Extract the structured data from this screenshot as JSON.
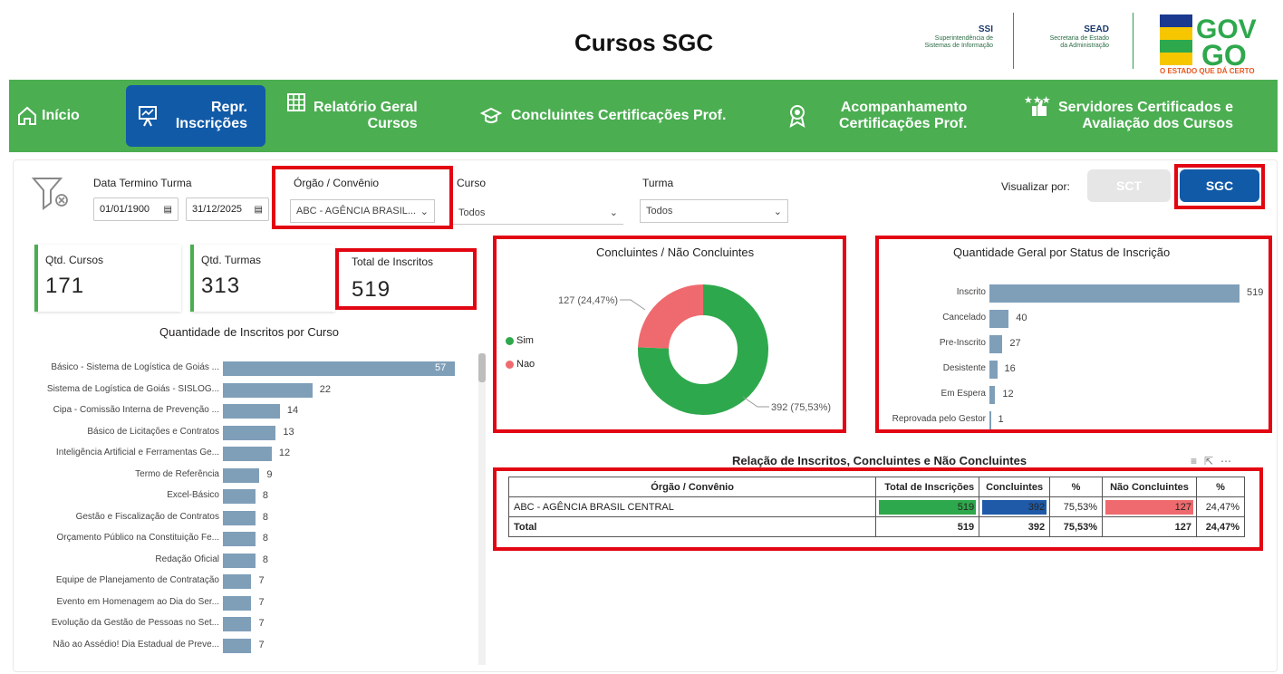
{
  "header": {
    "title": "Cursos SGC",
    "org1_abbr": "SSI",
    "org1_line1": "Superintendência de",
    "org1_line2": "Sistemas de Informação",
    "org2_abbr": "SEAD",
    "org2_line1": "Secretaria de Estado",
    "org2_line2": "da Administração",
    "logo_text": "GOV GO",
    "logo_tagline": "O ESTADO QUE DÁ CERTO"
  },
  "nav": [
    {
      "line1": "Início",
      "line2": "",
      "icon": "home-icon"
    },
    {
      "line1": "Repr.",
      "line2": "Inscrições",
      "icon": "presentation-icon"
    },
    {
      "line1": "Relatório Geral",
      "line2": "Cursos",
      "icon": "grid-icon"
    },
    {
      "line1": "Concluintes Certificações Prof.",
      "line2": "",
      "icon": "graduation-cap-icon"
    },
    {
      "line1": "Acompanhamento",
      "line2": "Certificações Prof.",
      "icon": "award-icon"
    },
    {
      "line1": "Servidores Certificados e",
      "line2": "Avaliação dos Cursos",
      "icon": "stars-thumb-icon"
    }
  ],
  "filters": {
    "date_label": "Data Termino Turma",
    "date_from": "01/01/1900",
    "date_to": "31/12/2025",
    "orgao_label": "Órgão / Convênio",
    "orgao_value": "ABC - AGÊNCIA BRASIL...",
    "curso_label": "Curso",
    "curso_value": "Todos",
    "turma_label": "Turma",
    "turma_value": "Todos",
    "visualizar_label": "Visualizar por:",
    "btn_sct": "SCT",
    "btn_sgc": "SGC"
  },
  "cards": [
    {
      "label": "Qtd. Cursos",
      "value": "171"
    },
    {
      "label": "Qtd. Turmas",
      "value": "313"
    },
    {
      "label": "Total de Inscritos",
      "value": "519"
    }
  ],
  "courses_chart": {
    "title": "Quantidade de Inscritos por Curso",
    "max": 57,
    "items": [
      {
        "label": "Básico - Sistema de Logística de Goiás ...",
        "value": 57
      },
      {
        "label": "Sistema de Logística de Goiás - SISLOG...",
        "value": 22
      },
      {
        "label": "Cipa - Comissão Interna de Prevenção ...",
        "value": 14
      },
      {
        "label": "Básico de Licitações e Contratos",
        "value": 13
      },
      {
        "label": "Inteligência Artificial e Ferramentas Ge...",
        "value": 12
      },
      {
        "label": "Termo de Referência",
        "value": 9
      },
      {
        "label": "Excel-Básico",
        "value": 8
      },
      {
        "label": "Gestão e Fiscalização de Contratos",
        "value": 8
      },
      {
        "label": "Orçamento Público na Constituição Fe...",
        "value": 8
      },
      {
        "label": "Redação Oficial",
        "value": 8
      },
      {
        "label": "Equipe de Planejamento de Contratação",
        "value": 7
      },
      {
        "label": "Evento em Homenagem ao Dia do Ser...",
        "value": 7
      },
      {
        "label": "Evolução da Gestão de Pessoas no Set...",
        "value": 7
      },
      {
        "label": "Não ao Assédio! Dia Estadual de Preve...",
        "value": 7
      }
    ]
  },
  "donut": {
    "title": "Concluintes / Não Concluintes",
    "legend": [
      {
        "name": "Sim",
        "color": "#2ea84c"
      },
      {
        "name": "Nao",
        "color": "#ef6a6e"
      }
    ],
    "slices": [
      {
        "name": "Sim",
        "value": 392,
        "label": "392 (75,53%)",
        "color": "#2ea84c"
      },
      {
        "name": "Nao",
        "value": 127,
        "label": "127 (24,47%)",
        "color": "#ef6a6e"
      }
    ]
  },
  "status_chart": {
    "title": "Quantidade Geral por Status de Inscrição",
    "max": 519,
    "items": [
      {
        "label": "Inscrito",
        "value": 519
      },
      {
        "label": "Cancelado",
        "value": 40
      },
      {
        "label": "Pre-Inscrito",
        "value": 27
      },
      {
        "label": "Desistente",
        "value": 16
      },
      {
        "label": "Em Espera",
        "value": 12
      },
      {
        "label": "Reprovada pelo Gestor",
        "value": 1
      }
    ]
  },
  "table": {
    "title": "Relação de Inscritos, Concluintes e Não Concluintes",
    "headers": [
      "Órgão / Convênio",
      "Total de Inscrições",
      "Concluintes",
      "%",
      "Não Concluintes",
      "%"
    ],
    "row": [
      "ABC - AGÊNCIA BRASIL CENTRAL",
      "519",
      "392",
      "75,53%",
      "127",
      "24,47%"
    ],
    "total": [
      "Total",
      "519",
      "392",
      "75,53%",
      "127",
      "24,47%"
    ]
  },
  "chart_data": [
    {
      "type": "bar",
      "title": "Quantidade de Inscritos por Curso",
      "categories": [
        "Básico - Sistema de Logística de Goiás ...",
        "Sistema de Logística de Goiás - SISLOG...",
        "Cipa - Comissão Interna de Prevenção ...",
        "Básico de Licitações e Contratos",
        "Inteligência Artificial e Ferramentas Ge...",
        "Termo de Referência",
        "Excel-Básico",
        "Gestão e Fiscalização de Contratos",
        "Orçamento Público na Constituição Fe...",
        "Redação Oficial",
        "Equipe de Planejamento de Contratação",
        "Evento em Homenagem ao Dia do Ser...",
        "Evolução da Gestão de Pessoas no Set...",
        "Não ao Assédio! Dia Estadual de Preve..."
      ],
      "values": [
        57,
        22,
        14,
        13,
        12,
        9,
        8,
        8,
        8,
        8,
        7,
        7,
        7,
        7
      ]
    },
    {
      "type": "pie",
      "title": "Concluintes / Não Concluintes",
      "categories": [
        "Sim",
        "Nao"
      ],
      "values": [
        392,
        127
      ]
    },
    {
      "type": "bar",
      "title": "Quantidade Geral por Status de Inscrição",
      "categories": [
        "Inscrito",
        "Cancelado",
        "Pre-Inscrito",
        "Desistente",
        "Em Espera",
        "Reprovada pelo Gestor"
      ],
      "values": [
        519,
        40,
        27,
        16,
        12,
        1
      ]
    }
  ]
}
